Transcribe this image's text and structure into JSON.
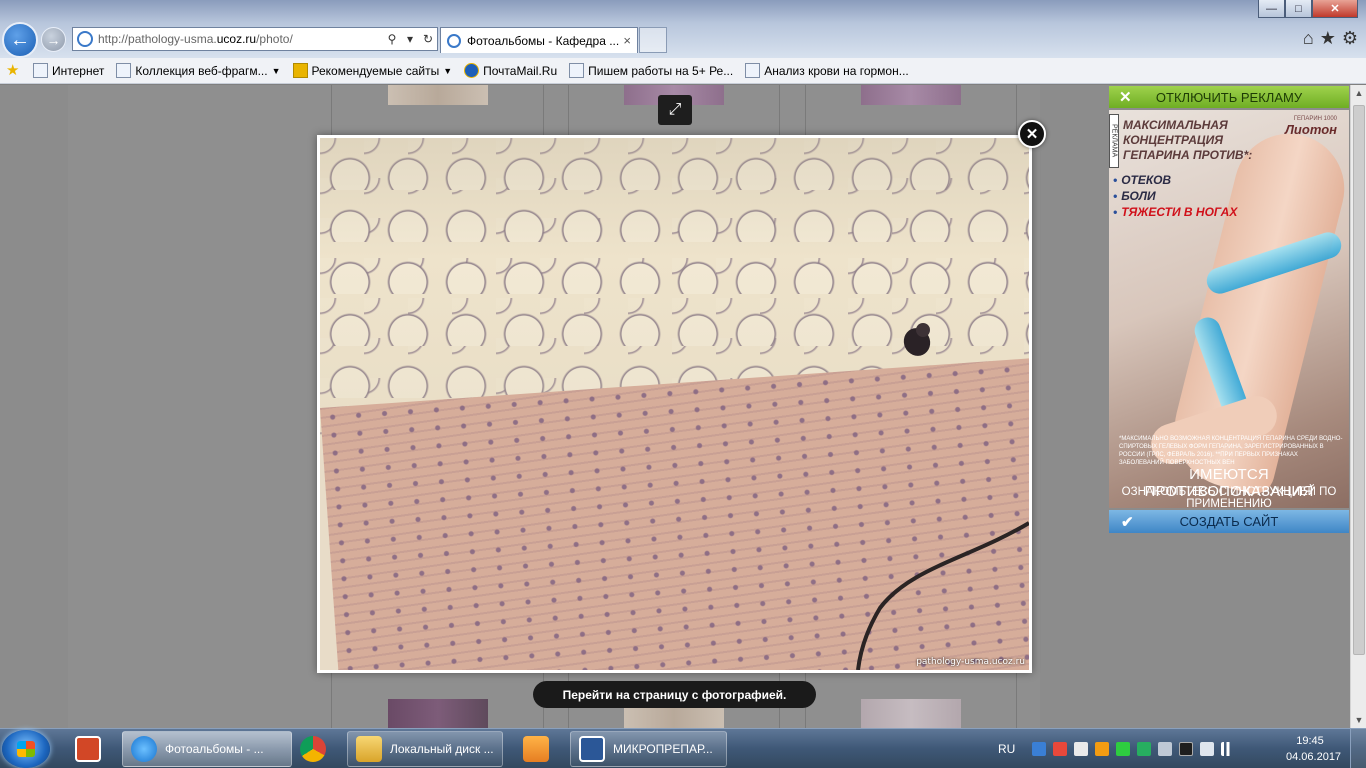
{
  "browser": {
    "url_prefix": "http://pathology-usma.",
    "url_domain": "ucoz.ru",
    "url_suffix": "/photo/",
    "tab_title": "Фотоальбомы - Кафедра ...",
    "tab_close": "×",
    "window_buttons": {
      "minimize": "—",
      "maximize": "□",
      "close": "✕"
    },
    "nav": {
      "back": "←",
      "forward": "→"
    },
    "address_icons": {
      "search": "⚲",
      "dropdown": "▾",
      "refresh": "↻"
    },
    "tool_icons": {
      "home": "⌂",
      "favorites": "★",
      "settings": "⚙"
    }
  },
  "favorites": [
    {
      "label": "Интернет",
      "icon": "ie-page-icon"
    },
    {
      "label": "Коллекция веб-фрагм...",
      "icon": "ie-page-icon",
      "dropdown": "▼"
    },
    {
      "label": "Рекомендуемые сайты",
      "icon": "bing-icon",
      "dropdown": "▼"
    },
    {
      "label": "ПочтаMail.Ru",
      "icon": "mail-icon"
    },
    {
      "label": "Пишем работы на 5+  Ре...",
      "icon": "ie-page-icon"
    },
    {
      "label": "Анализ крови на гормон...",
      "icon": "ie-page-icon"
    }
  ],
  "lightbox": {
    "expand_icon": "⤢",
    "close_icon": "✕",
    "watermark": "pathology-usma.ucoz.ru",
    "goto_page_label": "Перейти на страницу с фотографией."
  },
  "ad": {
    "disable_label": "ОТКЛЮЧИТЬ РЕКЛАМУ",
    "disable_icon": "✕",
    "tag": "РЕКЛАМА",
    "brand": "Лиотон",
    "brand_small": "ГЕПАРИН 1000",
    "headline": "МАКСИМАЛЬНАЯ КОНЦЕНТРАЦИЯ ГЕПАРИНА ПРОТИВ*:",
    "items": [
      "ОТЕКОВ",
      "БОЛИ",
      "ТЯЖЕСТИ В НОГАХ"
    ],
    "fine_print": "*МАКСИМАЛЬНО ВОЗМОЖНАЯ КОНЦЕНТРАЦИЯ ГЕПАРИНА СРЕДИ ВОДНО-СПИРТОВЫХ ГЕЛЕВЫХ ФОРМ ГЕПАРИНА, ЗАРЕГИСТРИРОВАННЫХ В РОССИИ (ГРЛС, ФЕВРАЛЬ 2016). **ПРИ ПЕРВЫХ ПРИЗНАКАХ ЗАБОЛЕВАНИЙ ПОВЕРХНОСТНЫХ ВЕН",
    "contraindications": "ИМЕЮТСЯ ПРОТИВОПОКАЗАНИЯ",
    "instructions": "ОЗНАКОМЬТЕСЬ С ИНСТРУКЦИЕЙ ПО ПРИМЕНЕНИЮ",
    "create_site_label": "СОЗДАТЬ САЙТ",
    "create_site_icon": "✔"
  },
  "scrollbar": {
    "up": "▲",
    "down": "▼"
  },
  "taskbar": {
    "tasks": [
      {
        "label": "Фотоальбомы - ...",
        "active": true
      },
      {
        "label": "Локальный диск ...",
        "active": false
      },
      {
        "label": "МИКРОПРЕПАР...",
        "active": false
      }
    ],
    "language": "RU",
    "time": "19:45",
    "date": "04.06.2017"
  }
}
